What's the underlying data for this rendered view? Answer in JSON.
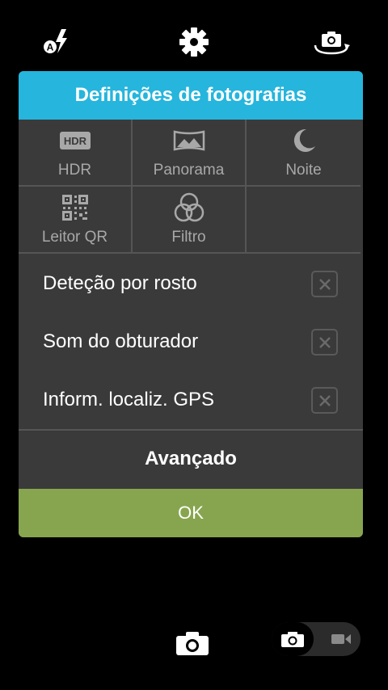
{
  "topbar": {
    "icons": [
      "flash-auto-icon",
      "settings-gear-icon",
      "switch-camera-icon"
    ],
    "flash_badge": "A"
  },
  "dialog": {
    "title": "Definições de fotografias",
    "modes": [
      {
        "label": "HDR",
        "icon": "hdr-icon",
        "icon_text": "HDR"
      },
      {
        "label": "Panorama",
        "icon": "panorama-icon"
      },
      {
        "label": "Noite",
        "icon": "moon-icon"
      },
      {
        "label": "Leitor QR",
        "icon": "qr-code-icon"
      },
      {
        "label": "Filtro",
        "icon": "filter-icon"
      }
    ],
    "toggles": [
      {
        "label": "Deteção por rosto",
        "checked": false
      },
      {
        "label": "Som do obturador",
        "checked": false
      },
      {
        "label": "Inform. localiz. GPS",
        "checked": false
      }
    ],
    "advanced_label": "Avançado",
    "ok_label": "OK"
  },
  "bottombar": {
    "mode_selected": "photo"
  },
  "colors": {
    "header": "#26b5dc",
    "ok": "#87a54f",
    "panel": "#3a3a3a"
  }
}
